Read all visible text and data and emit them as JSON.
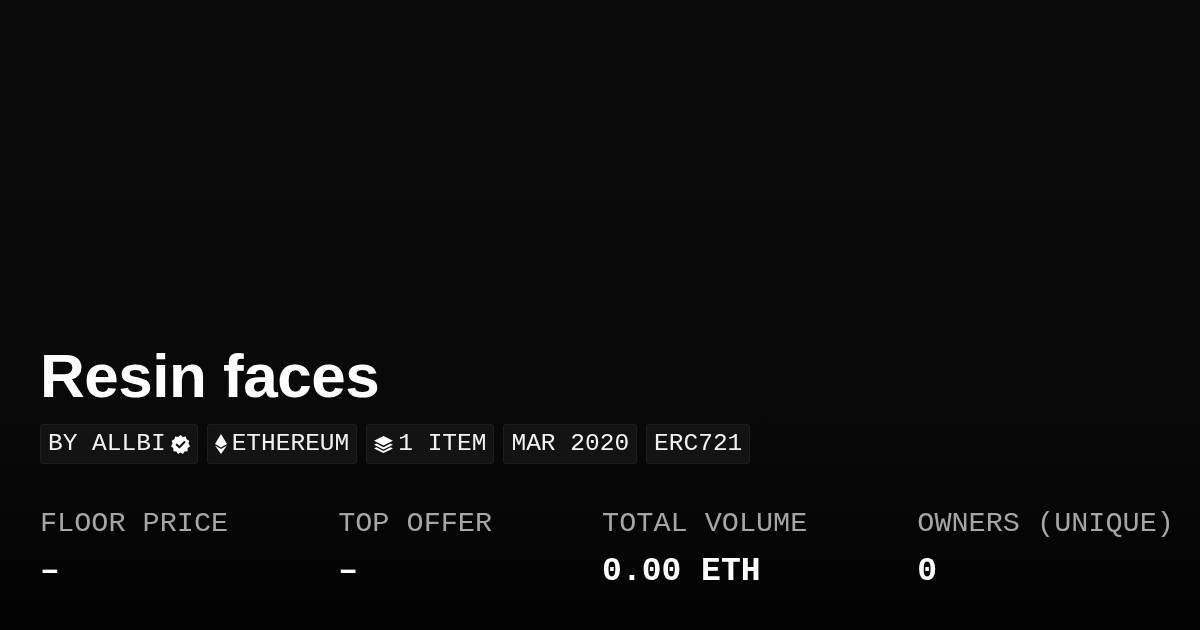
{
  "title": "Resin faces",
  "tags": [
    {
      "kind": "creator",
      "label": "BY ALLBI",
      "verified": true
    },
    {
      "kind": "chain",
      "label": "ETHEREUM"
    },
    {
      "kind": "items",
      "label": "1 ITEM"
    },
    {
      "kind": "plain",
      "label": "MAR 2020"
    },
    {
      "kind": "plain",
      "label": "ERC721"
    }
  ],
  "stats": [
    {
      "label": "FLOOR PRICE",
      "value": "–"
    },
    {
      "label": "TOP OFFER",
      "value": "–"
    },
    {
      "label": "TOTAL VOLUME",
      "value": "0.00 ETH"
    },
    {
      "label": "OWNERS (UNIQUE)",
      "value": "0"
    }
  ]
}
